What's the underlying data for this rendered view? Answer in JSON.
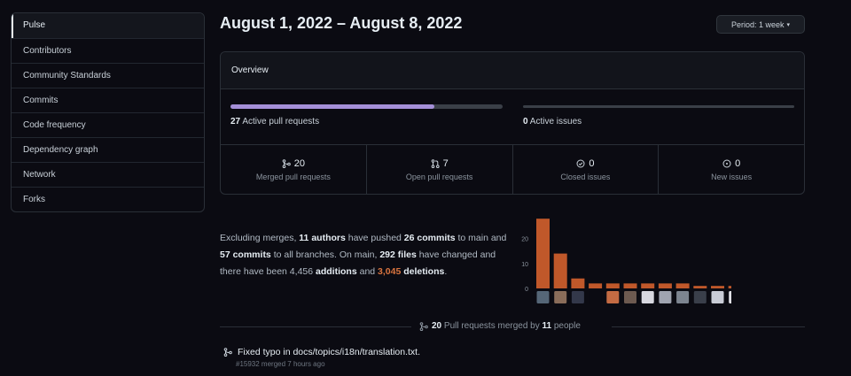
{
  "sidebar": {
    "items": [
      {
        "label": "Pulse",
        "active": true
      },
      {
        "label": "Contributors"
      },
      {
        "label": "Community Standards"
      },
      {
        "label": "Commits"
      },
      {
        "label": "Code frequency"
      },
      {
        "label": "Dependency graph"
      },
      {
        "label": "Network"
      },
      {
        "label": "Forks"
      }
    ]
  },
  "header": {
    "title": "August 1, 2022 – August 8, 2022",
    "period_label": "Period: 1 week"
  },
  "overview": {
    "title": "Overview",
    "pull_requests": {
      "count": "27",
      "label": "Active pull requests",
      "merged_fraction": 0.75
    },
    "issues": {
      "count": "0",
      "label": "Active issues"
    },
    "stats": [
      {
        "icon": "merge-icon",
        "value": "20",
        "label": "Merged pull requests"
      },
      {
        "icon": "open-pr-icon",
        "value": "7",
        "label": "Open pull requests"
      },
      {
        "icon": "closed-issue-icon",
        "value": "0",
        "label": "Closed issues"
      },
      {
        "icon": "new-issue-icon",
        "value": "0",
        "label": "New issues"
      }
    ]
  },
  "summary": {
    "t1": "Excluding merges, ",
    "authors": "11 authors",
    "t2": " have pushed ",
    "commits_main": "26 commits",
    "t3": " to main and ",
    "commits_all": "57 commits",
    "t4": " to all branches. On main, ",
    "files": "292 files",
    "t5": " have changed and there have been 4,456 ",
    "additions": "additions",
    "t6": " and ",
    "deletions_count": "3,045",
    "deletions_word": "deletions",
    "t7": "."
  },
  "chart_data": {
    "type": "bar",
    "color": "#c0582a",
    "yticks": [
      "20",
      "10",
      "0"
    ],
    "ylim": [
      0,
      27
    ],
    "values": [
      28,
      14,
      4,
      2,
      2,
      2,
      2,
      2,
      2,
      1,
      1,
      1
    ],
    "avatar_colors": [
      "#556677",
      "#8a6d5a",
      "#33384a",
      "#0b0b12",
      "#c46b43",
      "#6d5a50",
      "#d8d8e0",
      "#a0a4b0",
      "#7d8590",
      "#3a3f4a",
      "#c9ccd6",
      "#e0e0e6"
    ]
  },
  "merged": {
    "count": "20",
    "text": " Pull requests merged by ",
    "people_count": "11",
    "people_word": " people"
  },
  "pr_list": [
    {
      "title": "Fixed typo in docs/topics/i18n/translation.txt.",
      "meta": "#15932 merged 7 hours ago"
    }
  ]
}
